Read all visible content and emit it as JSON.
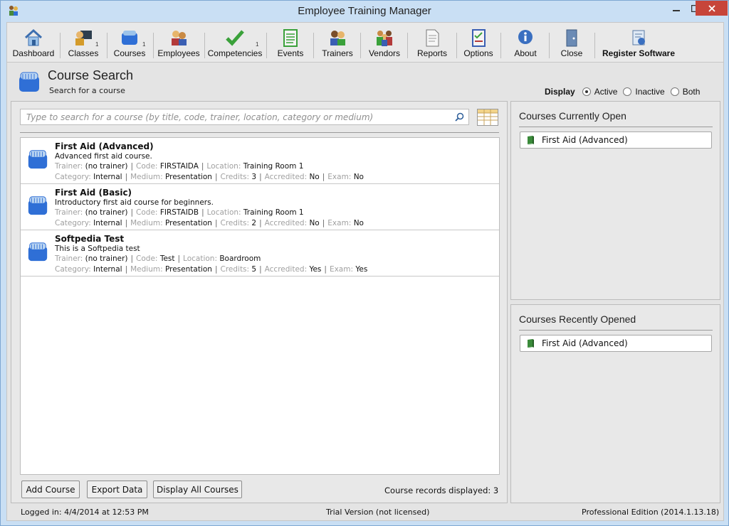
{
  "window": {
    "title": "Employee Training Manager"
  },
  "toolbar": {
    "items": [
      {
        "label": "Dashboard",
        "icon": "house-icon",
        "count": ""
      },
      {
        "label": "Classes",
        "icon": "classroom-icon",
        "count": "1"
      },
      {
        "label": "Courses",
        "icon": "course-icon",
        "count": "1"
      },
      {
        "label": "Employees",
        "icon": "employees-icon",
        "count": ""
      },
      {
        "label": "Competencies",
        "icon": "checkmark-icon",
        "count": "1"
      },
      {
        "label": "Events",
        "icon": "events-icon",
        "count": ""
      },
      {
        "label": "Trainers",
        "icon": "trainers-icon",
        "count": ""
      },
      {
        "label": "Vendors",
        "icon": "vendors-icon",
        "count": ""
      },
      {
        "label": "Reports",
        "icon": "report-icon",
        "count": ""
      },
      {
        "label": "Options",
        "icon": "options-icon",
        "count": ""
      },
      {
        "label": "About",
        "icon": "info-icon",
        "count": ""
      },
      {
        "label": "Close",
        "icon": "door-icon",
        "count": ""
      },
      {
        "label": "Register Software",
        "icon": "register-icon",
        "count": ""
      }
    ]
  },
  "header": {
    "title": "Course Search",
    "subtitle": "Search for a course"
  },
  "display": {
    "label": "Display",
    "options": [
      {
        "label": "Active",
        "selected": true
      },
      {
        "label": "Inactive",
        "selected": false
      },
      {
        "label": "Both",
        "selected": false
      }
    ]
  },
  "search": {
    "placeholder": "Type to search for a course (by title, code, trainer, location, category or medium)",
    "value": ""
  },
  "labels": {
    "trainer": "Trainer:",
    "code": "Code:",
    "location": "Location:",
    "category": "Category:",
    "medium": "Medium:",
    "credits": "Credits:",
    "accredited": "Accredited:",
    "exam": "Exam:"
  },
  "courses": [
    {
      "title": "First Aid (Advanced)",
      "description": "Advanced first aid course.",
      "trainer": "(no trainer)",
      "code": "FIRSTAIDA",
      "location": "Training Room 1",
      "category": "Internal",
      "medium": "Presentation",
      "credits": "3",
      "accredited": "No",
      "exam": "No"
    },
    {
      "title": "First Aid (Basic)",
      "description": "Introductory first aid course for beginners.",
      "trainer": "(no trainer)",
      "code": "FIRSTAIDB",
      "location": "Training Room 1",
      "category": "Internal",
      "medium": "Presentation",
      "credits": "2",
      "accredited": "No",
      "exam": "No"
    },
    {
      "title": "Softpedia Test",
      "description": "This is a Softpedia test",
      "trainer": "(no trainer)",
      "code": "Test",
      "location": "Boardroom",
      "category": "Internal",
      "medium": "Presentation",
      "credits": "5",
      "accredited": "Yes",
      "exam": "Yes"
    }
  ],
  "buttons": {
    "add": "Add Course",
    "export": "Export Data",
    "display_all": "Display All Courses"
  },
  "records": "Course records displayed: 3",
  "open_panel": {
    "title": "Courses Currently Open",
    "items": [
      "First Aid (Advanced)"
    ]
  },
  "recent_panel": {
    "title": "Courses Recently Opened",
    "items": [
      "First Aid (Advanced)"
    ]
  },
  "status": {
    "logged_in": "Logged in:  4/4/2014 at 12:53 PM",
    "trial": "Trial Version (not licensed)",
    "edition": "Professional Edition (2014.1.13.18)"
  },
  "colors": {
    "accent": "#2f6fd6",
    "title_bg": "#c9dff4",
    "close_btn": "#c7453a"
  }
}
